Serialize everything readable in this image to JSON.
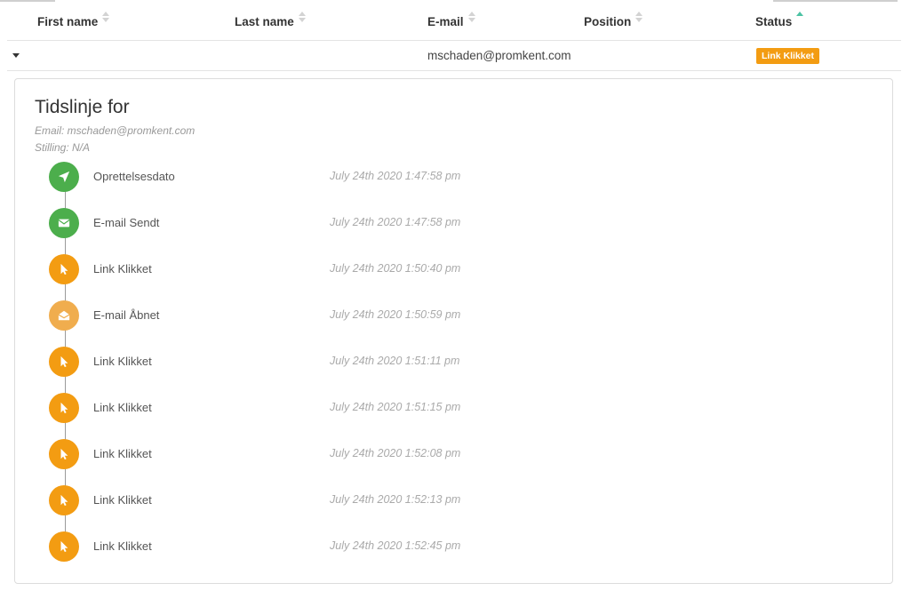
{
  "table": {
    "columns": [
      {
        "label": "First name",
        "sort": "none"
      },
      {
        "label": "Last name",
        "sort": "none"
      },
      {
        "label": "E-mail",
        "sort": "none"
      },
      {
        "label": "Position",
        "sort": "none"
      },
      {
        "label": "Status",
        "sort": "ascending"
      }
    ],
    "row": {
      "first_name": "",
      "last_name": "",
      "email": "mschaden@promkent.com",
      "position": "",
      "status": "Link Klikket",
      "status_color": "#f39c12"
    }
  },
  "timeline": {
    "title": "Tidslinje for",
    "email": "Email: mschaden@promkent.com",
    "position": "Stilling: N/A",
    "events": [
      {
        "label": "Oprettelsesdato",
        "time": "July 24th 2020 1:47:58 pm",
        "icon": "rocket-icon",
        "color": "#4cae4c"
      },
      {
        "label": "E-mail Sendt",
        "time": "July 24th 2020 1:47:58 pm",
        "icon": "envelope-icon",
        "color": "#4cae4c"
      },
      {
        "label": "Link Klikket",
        "time": "July 24th 2020 1:50:40 pm",
        "icon": "pointer-icon",
        "color": "#f39c12"
      },
      {
        "label": "E-mail Åbnet",
        "time": "July 24th 2020 1:50:59 pm",
        "icon": "envelope-open-icon",
        "color": "#f0ad4e"
      },
      {
        "label": "Link Klikket",
        "time": "July 24th 2020 1:51:11 pm",
        "icon": "pointer-icon",
        "color": "#f39c12"
      },
      {
        "label": "Link Klikket",
        "time": "July 24th 2020 1:51:15 pm",
        "icon": "pointer-icon",
        "color": "#f39c12"
      },
      {
        "label": "Link Klikket",
        "time": "July 24th 2020 1:52:08 pm",
        "icon": "pointer-icon",
        "color": "#f39c12"
      },
      {
        "label": "Link Klikket",
        "time": "July 24th 2020 1:52:13 pm",
        "icon": "pointer-icon",
        "color": "#f39c12"
      },
      {
        "label": "Link Klikket",
        "time": "July 24th 2020 1:52:45 pm",
        "icon": "pointer-icon",
        "color": "#f39c12"
      }
    ]
  }
}
